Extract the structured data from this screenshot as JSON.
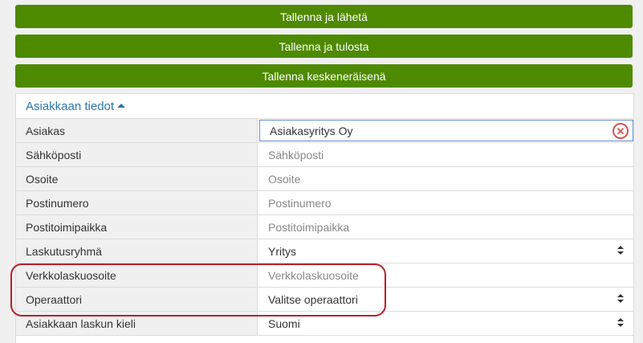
{
  "buttons": {
    "save_send": "Tallenna ja lähetä",
    "save_print": "Tallenna ja tulosta",
    "save_draft": "Tallenna keskeneräisenä"
  },
  "panel": {
    "title": "Asiakkaan tiedot",
    "rows": [
      {
        "label": "Asiakas",
        "value": "Asiakasyritys Oy",
        "type": "input-filled"
      },
      {
        "label": "Sähköposti",
        "placeholder": "Sähköposti",
        "type": "input"
      },
      {
        "label": "Osoite",
        "placeholder": "Osoite",
        "type": "input"
      },
      {
        "label": "Postinumero",
        "placeholder": "Postinumero",
        "type": "input"
      },
      {
        "label": "Postitoimipaikka",
        "placeholder": "Postitoimipaikka",
        "type": "input"
      },
      {
        "label": "Laskutusryhmä",
        "value": "Yritys",
        "type": "select"
      },
      {
        "label": "Verkkolaskuosoite",
        "placeholder": "Verkkolaskuosoite",
        "type": "input"
      },
      {
        "label": "Operaattori",
        "value": "Valitse operaattori",
        "type": "select"
      },
      {
        "label": "Asiakkaan laskun kieli",
        "value": "Suomi",
        "type": "select"
      }
    ]
  },
  "colors": {
    "button_bg": "#4e8a00",
    "header_text": "#2a78ad",
    "highlight": "#b8202b",
    "clear_icon": "#d9534f"
  },
  "icons": {
    "header_toggle": "caret-up-icon",
    "clear": "clear-circle-x-icon",
    "select": "sort-arrows-icon"
  }
}
